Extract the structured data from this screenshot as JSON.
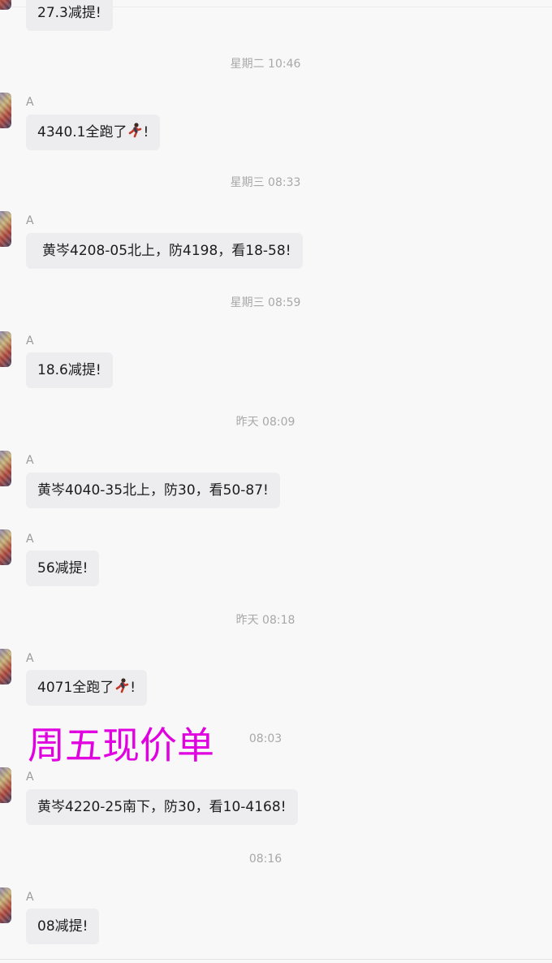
{
  "overlay_text": "周五现价单",
  "messages": [
    {
      "sender": "A",
      "text": "27.3减提!",
      "has_runner": false
    },
    {
      "timestamp": "星期二 10:46",
      "sender": "A",
      "text": "4340.1全跑了",
      "suffix": "!",
      "has_runner": true
    },
    {
      "timestamp": "星期三 08:33",
      "sender": "A",
      "text": "黄岑4208-05北上，防4198，看18-58!"
    },
    {
      "timestamp": "星期三 08:59",
      "sender": "A",
      "text": "18.6减提!"
    },
    {
      "timestamp": "昨天 08:09",
      "sender": "A",
      "text": "黄岑4040-35北上，防30，看50-87!"
    },
    {
      "sender": "A",
      "text": "56减提!"
    },
    {
      "timestamp": "昨天 08:18",
      "sender": "A",
      "text": "4071全跑了",
      "suffix": "!",
      "has_runner": true
    },
    {
      "timestamp": "08:03",
      "sender": "A",
      "text": "黄岑4220-25南下，防30，看10-4168!"
    },
    {
      "timestamp": "08:16",
      "sender": "A",
      "text": "08减提!"
    }
  ],
  "icons": {
    "avatar": "avatar-image",
    "runner": "running-person-emoji"
  }
}
